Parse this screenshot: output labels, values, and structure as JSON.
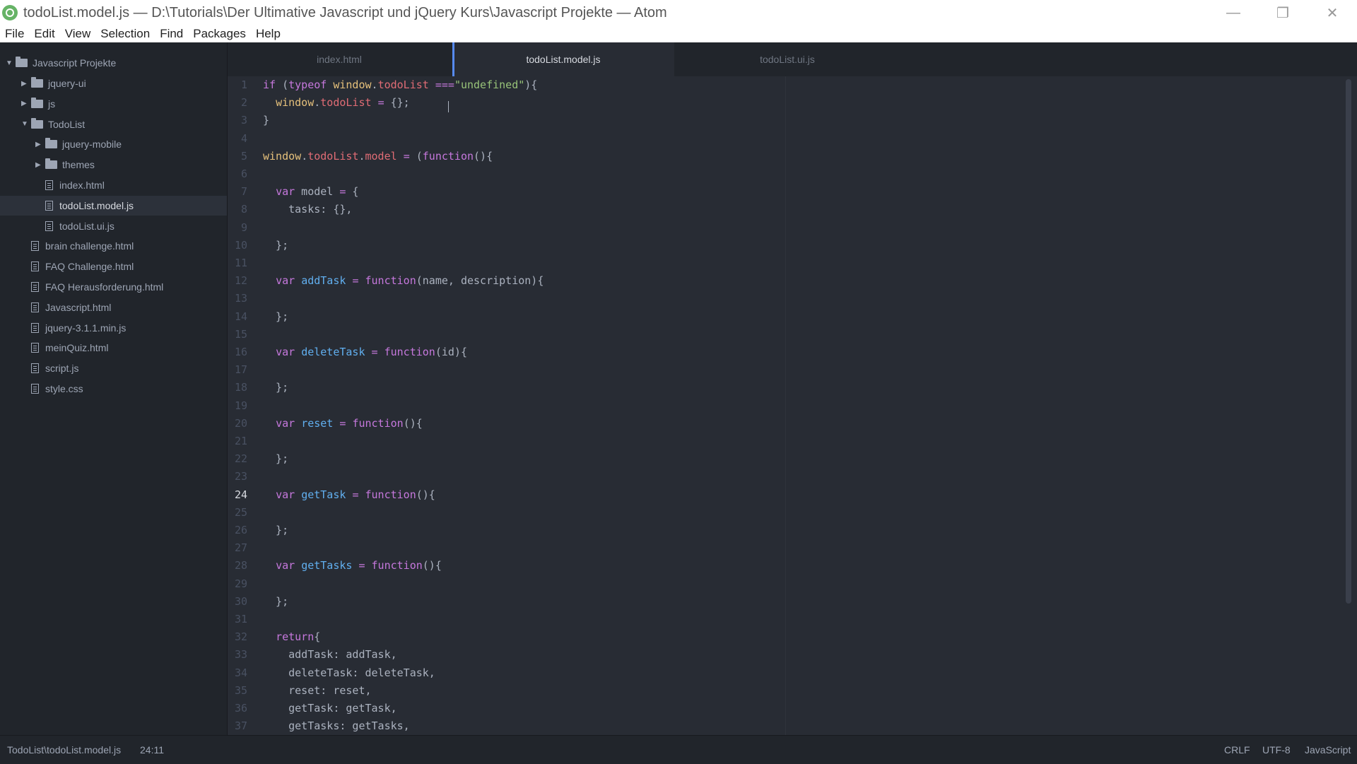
{
  "window": {
    "title": "todoList.model.js — D:\\Tutorials\\Der Ultimative Javascript und jQuery Kurs\\Javascript Projekte — Atom",
    "buttons": {
      "minimize": "—",
      "maximize": "❐",
      "close": "✕"
    }
  },
  "menu": [
    "File",
    "Edit",
    "View",
    "Selection",
    "Find",
    "Packages",
    "Help"
  ],
  "tree": {
    "root": "Javascript Projekte",
    "items": [
      {
        "label": "jquery-ui",
        "type": "folder",
        "state": "collapsed"
      },
      {
        "label": "js",
        "type": "folder",
        "state": "collapsed"
      },
      {
        "label": "TodoList",
        "type": "folder",
        "state": "expanded"
      },
      {
        "label": "jquery-mobile",
        "type": "folder",
        "state": "collapsed"
      },
      {
        "label": "themes",
        "type": "folder",
        "state": "collapsed"
      },
      {
        "label": "index.html",
        "type": "file"
      },
      {
        "label": "todoList.model.js",
        "type": "file",
        "selected": true
      },
      {
        "label": "todoList.ui.js",
        "type": "file"
      },
      {
        "label": "brain challenge.html",
        "type": "file"
      },
      {
        "label": "FAQ Challenge.html",
        "type": "file"
      },
      {
        "label": "FAQ Herausforderung.html",
        "type": "file"
      },
      {
        "label": "Javascript.html",
        "type": "file"
      },
      {
        "label": "jquery-3.1.1.min.js",
        "type": "file"
      },
      {
        "label": "meinQuiz.html",
        "type": "file"
      },
      {
        "label": "script.js",
        "type": "file"
      },
      {
        "label": "style.css",
        "type": "file"
      }
    ]
  },
  "tabs": [
    {
      "label": "index.html",
      "active": false
    },
    {
      "label": "todoList.model.js",
      "active": true
    },
    {
      "label": "todoList.ui.js",
      "active": false
    }
  ],
  "editor": {
    "current_line": 24,
    "lines": [
      [
        [
          "k",
          "if"
        ],
        [
          "t",
          " ("
        ],
        [
          "k",
          "typeof"
        ],
        [
          "t",
          " "
        ],
        [
          "v",
          "window"
        ],
        [
          "t",
          "."
        ],
        [
          "p",
          "todoList"
        ],
        [
          "t",
          " "
        ],
        [
          "k",
          "==="
        ],
        [
          "s",
          "\"undefined\""
        ],
        [
          "t",
          "){"
        ]
      ],
      [
        [
          "t",
          "  "
        ],
        [
          "v",
          "window"
        ],
        [
          "t",
          "."
        ],
        [
          "p",
          "todoList"
        ],
        [
          "t",
          " "
        ],
        [
          "k",
          "="
        ],
        [
          "t",
          " {};"
        ]
      ],
      [
        [
          "t",
          "}"
        ]
      ],
      [],
      [
        [
          "v",
          "window"
        ],
        [
          "t",
          "."
        ],
        [
          "p",
          "todoList"
        ],
        [
          "t",
          "."
        ],
        [
          "p",
          "model"
        ],
        [
          "t",
          " "
        ],
        [
          "k",
          "="
        ],
        [
          "t",
          " ("
        ],
        [
          "k",
          "function"
        ],
        [
          "t",
          "(){"
        ]
      ],
      [],
      [
        [
          "t",
          "  "
        ],
        [
          "k",
          "var"
        ],
        [
          "t",
          " model "
        ],
        [
          "k",
          "="
        ],
        [
          "t",
          " {"
        ]
      ],
      [
        [
          "t",
          "    tasks: {},"
        ]
      ],
      [],
      [
        [
          "t",
          "  };"
        ]
      ],
      [],
      [
        [
          "t",
          "  "
        ],
        [
          "k",
          "var"
        ],
        [
          "t",
          " "
        ],
        [
          "f",
          "addTask"
        ],
        [
          "t",
          " "
        ],
        [
          "k",
          "="
        ],
        [
          "t",
          " "
        ],
        [
          "k",
          "function"
        ],
        [
          "t",
          "(name, description){"
        ]
      ],
      [],
      [
        [
          "t",
          "  };"
        ]
      ],
      [],
      [
        [
          "t",
          "  "
        ],
        [
          "k",
          "var"
        ],
        [
          "t",
          " "
        ],
        [
          "f",
          "deleteTask"
        ],
        [
          "t",
          " "
        ],
        [
          "k",
          "="
        ],
        [
          "t",
          " "
        ],
        [
          "k",
          "function"
        ],
        [
          "t",
          "(id){"
        ]
      ],
      [],
      [
        [
          "t",
          "  };"
        ]
      ],
      [],
      [
        [
          "t",
          "  "
        ],
        [
          "k",
          "var"
        ],
        [
          "t",
          " "
        ],
        [
          "f",
          "reset"
        ],
        [
          "t",
          " "
        ],
        [
          "k",
          "="
        ],
        [
          "t",
          " "
        ],
        [
          "k",
          "function"
        ],
        [
          "t",
          "(){"
        ]
      ],
      [],
      [
        [
          "t",
          "  };"
        ]
      ],
      [],
      [
        [
          "t",
          "  "
        ],
        [
          "k",
          "var"
        ],
        [
          "t",
          " "
        ],
        [
          "f",
          "getTask"
        ],
        [
          "t",
          " "
        ],
        [
          "k",
          "="
        ],
        [
          "t",
          " "
        ],
        [
          "k",
          "function"
        ],
        [
          "t",
          "(){"
        ]
      ],
      [],
      [
        [
          "t",
          "  };"
        ]
      ],
      [],
      [
        [
          "t",
          "  "
        ],
        [
          "k",
          "var"
        ],
        [
          "t",
          " "
        ],
        [
          "f",
          "getTasks"
        ],
        [
          "t",
          " "
        ],
        [
          "k",
          "="
        ],
        [
          "t",
          " "
        ],
        [
          "k",
          "function"
        ],
        [
          "t",
          "(){"
        ]
      ],
      [],
      [
        [
          "t",
          "  };"
        ]
      ],
      [],
      [
        [
          "t",
          "  "
        ],
        [
          "k",
          "return"
        ],
        [
          "t",
          "{"
        ]
      ],
      [
        [
          "t",
          "    addTask: addTask,"
        ]
      ],
      [
        [
          "t",
          "    deleteTask: deleteTask,"
        ]
      ],
      [
        [
          "t",
          "    reset: reset,"
        ]
      ],
      [
        [
          "t",
          "    getTask: getTask,"
        ]
      ],
      [
        [
          "t",
          "    getTasks: getTasks,"
        ]
      ]
    ]
  },
  "status": {
    "path": "TodoList\\todoList.model.js",
    "cursor": "24:11",
    "line_ending": "CRLF",
    "encoding": "UTF-8",
    "grammar": "JavaScript"
  }
}
